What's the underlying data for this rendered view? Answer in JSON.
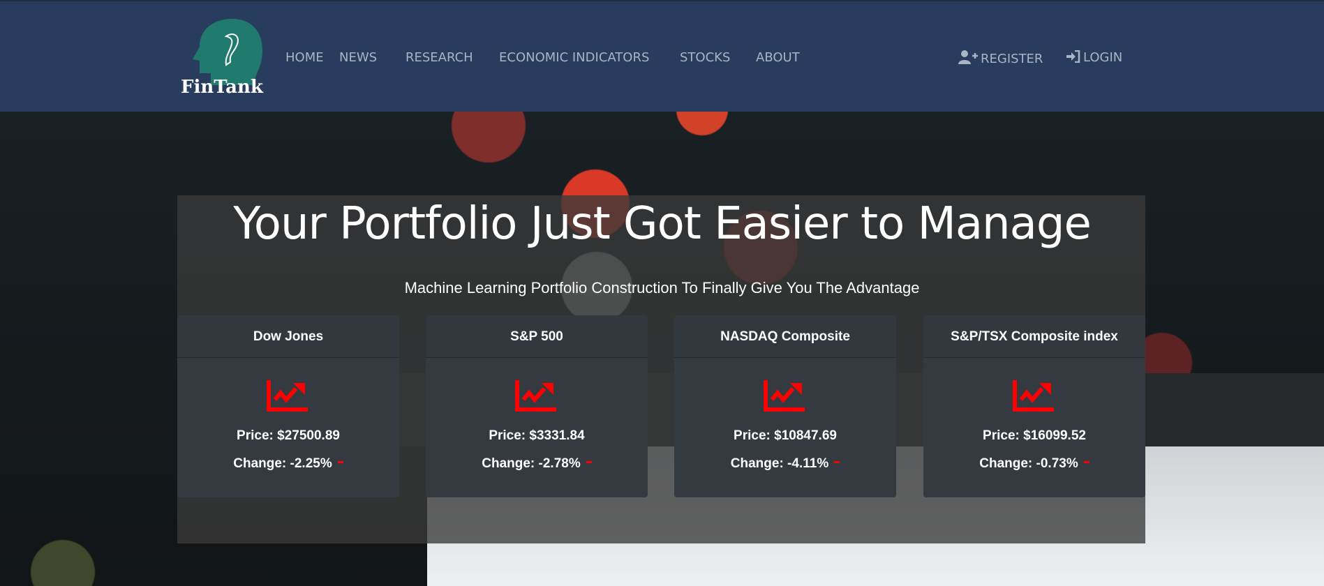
{
  "brand": {
    "name": "FinTank"
  },
  "nav": {
    "items": [
      "HOME",
      "NEWS",
      "RESEARCH",
      "ECONOMIC INDICATORS",
      "STOCKS",
      "ABOUT"
    ],
    "register": "REGISTER",
    "login": "LOGIN"
  },
  "hero": {
    "title": "Your Portfolio Just Got Easier to Manage",
    "subtitle": "Machine Learning Portfolio Construction To Finally Give You The Advantage"
  },
  "indices": [
    {
      "name": "Dow Jones",
      "price": "Price: $27500.89",
      "change": "Change: -2.25%"
    },
    {
      "name": "S&P 500",
      "price": "Price: $3331.84",
      "change": "Change: -2.78%"
    },
    {
      "name": "NASDAQ Composite",
      "price": "Price: $10847.69",
      "change": "Change: -4.11%"
    },
    {
      "name": "S&P/TSX Composite index",
      "price": "Price: $16099.52",
      "change": "Change: -0.73%"
    }
  ],
  "colors": {
    "nav": "#283c5e",
    "negative": "#ff0000",
    "card": "#343a40",
    "logo": "#217a6e"
  }
}
